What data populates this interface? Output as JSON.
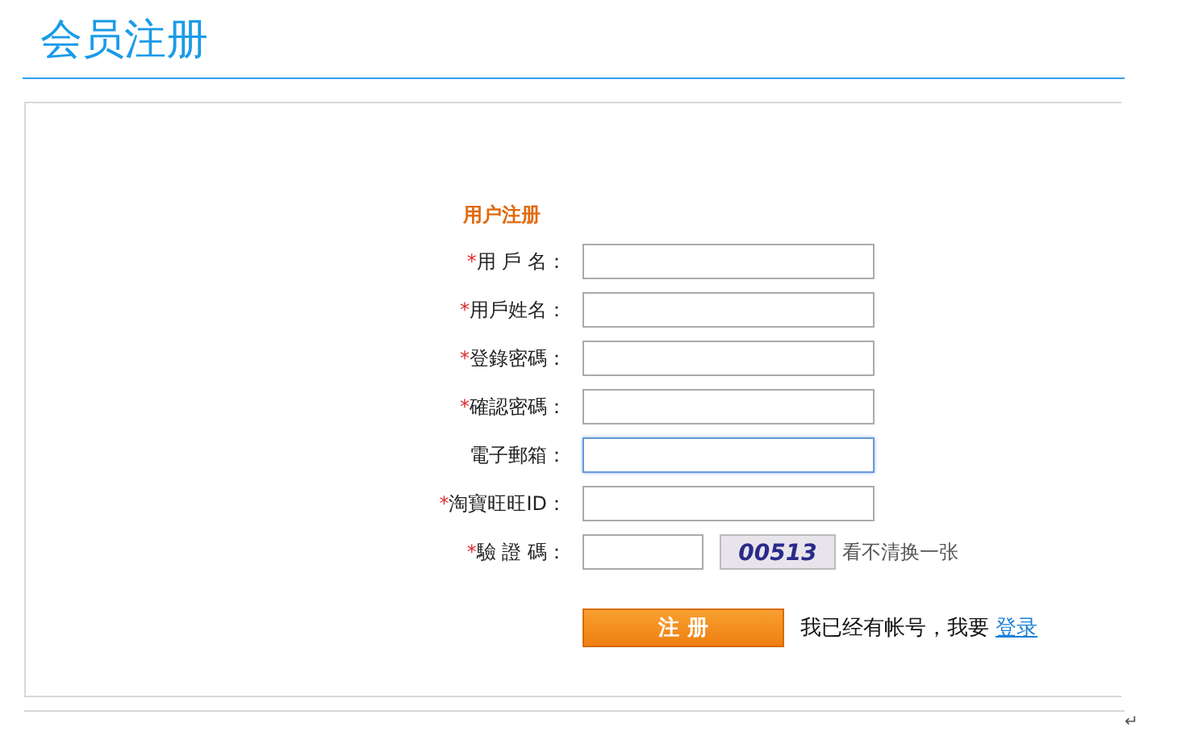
{
  "page_title": "会员注册",
  "form": {
    "heading": "用户注册",
    "fields": [
      {
        "label": "用 戶 名：",
        "required": true,
        "focused": false,
        "kind": "text"
      },
      {
        "label": "用戶姓名：",
        "required": true,
        "focused": false,
        "kind": "text"
      },
      {
        "label": "登錄密碼：",
        "required": true,
        "focused": false,
        "kind": "text"
      },
      {
        "label": "確認密碼：",
        "required": true,
        "focused": false,
        "kind": "text"
      },
      {
        "label": "電子郵箱：",
        "required": false,
        "focused": true,
        "kind": "text"
      },
      {
        "label": "淘寶旺旺ID：",
        "required": true,
        "focused": false,
        "kind": "text"
      },
      {
        "label": "驗 證 碼：",
        "required": true,
        "focused": false,
        "kind": "captcha",
        "captcha_text": "00513",
        "refresh_link": "看不清换一张"
      }
    ],
    "required_mark": "*",
    "submit_button": "注 册",
    "login_prompt": "我已经有帐号，我要",
    "login_link": "登录"
  },
  "paragraph_mark": "↵"
}
